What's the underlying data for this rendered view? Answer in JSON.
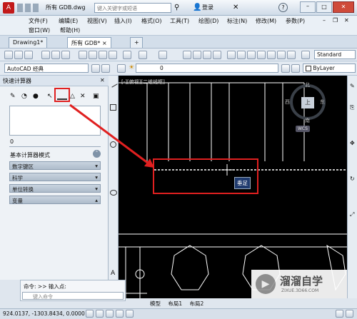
{
  "title": {
    "app_icon": "autocad-logo",
    "search_placeholder": "键入关键字或短语",
    "file_label": "所有 GDB.dwg",
    "login": "登录"
  },
  "menu": [
    "文件(F)",
    "编辑(E)",
    "视图(V)",
    "插入(I)",
    "格式(O)",
    "工具(T)",
    "绘图(D)",
    "标注(N)",
    "修改(M)",
    "参数(P)",
    "窗口(W)",
    "帮助(H)"
  ],
  "tabs": [
    "Drawing1*",
    "所有 GDB*"
  ],
  "toolbar": {
    "workspace": "AutoCAD 经典",
    "layer": "0",
    "linetype": "ByLayer",
    "style": "Standard"
  },
  "palette": {
    "title": "快速计算器",
    "display_value": "0",
    "sections_header": "基本计算器模式",
    "sections": [
      "数字键区",
      "科学",
      "单位转换",
      "变量"
    ]
  },
  "viewport": {
    "label": "[-][俯视][二维线框]",
    "compass": {
      "n": "北",
      "s": "南",
      "e": "东",
      "w": "西",
      "center": "上"
    },
    "wcs": "WCS",
    "tooltip": "垂足"
  },
  "command": {
    "line1": "命令: >> 输入点:",
    "input_placeholder": "键入命令"
  },
  "layout_tabs": [
    "模型",
    "布局1",
    "布局2"
  ],
  "status": {
    "coords": "924.0137,  -1303.8434,  0.0000"
  },
  "watermark": {
    "name": "溜溜自学",
    "url": "ZIXUE.3D66.COM"
  },
  "colors": {
    "highlight": "#e02020",
    "canvas": "#000000",
    "tooltip_bg": "#1f3a6e"
  }
}
